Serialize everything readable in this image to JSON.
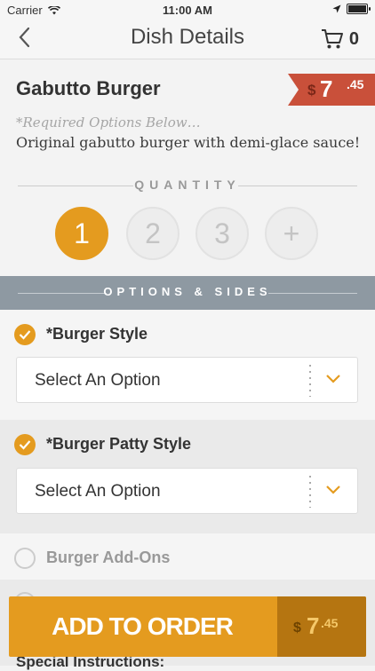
{
  "status_bar": {
    "carrier": "Carrier",
    "time": "11:00 AM"
  },
  "nav": {
    "title": "Dish Details",
    "cart_count": "0"
  },
  "dish": {
    "name": "Gabutto Burger",
    "price_symbol": "$",
    "price_whole": "7",
    "price_cents": ".45",
    "required_note": "*Required Options Below…",
    "description": "Original gabutto burger with demi-glace sauce!"
  },
  "quantity": {
    "label": "QUANTITY",
    "options": [
      "1",
      "2",
      "3",
      "+"
    ],
    "selected": "1"
  },
  "options_header": "OPTIONS & SIDES",
  "option_groups": [
    {
      "title": "*Burger Style",
      "select_value": "Select An Option",
      "checked": true
    },
    {
      "title": "*Burger Patty Style",
      "select_value": "Select An Option",
      "checked": true
    },
    {
      "title": "Burger Add-Ons",
      "checked": false
    },
    {
      "title": "Special Instructions:"
    }
  ],
  "add_to_order": {
    "label": "ADD TO ORDER",
    "price_symbol": "$",
    "price_whole": "7",
    "price_cents": ".45"
  },
  "colors": {
    "accent": "#e49b1f",
    "price_ribbon": "#c9503a",
    "section_header": "#8e99a2"
  }
}
